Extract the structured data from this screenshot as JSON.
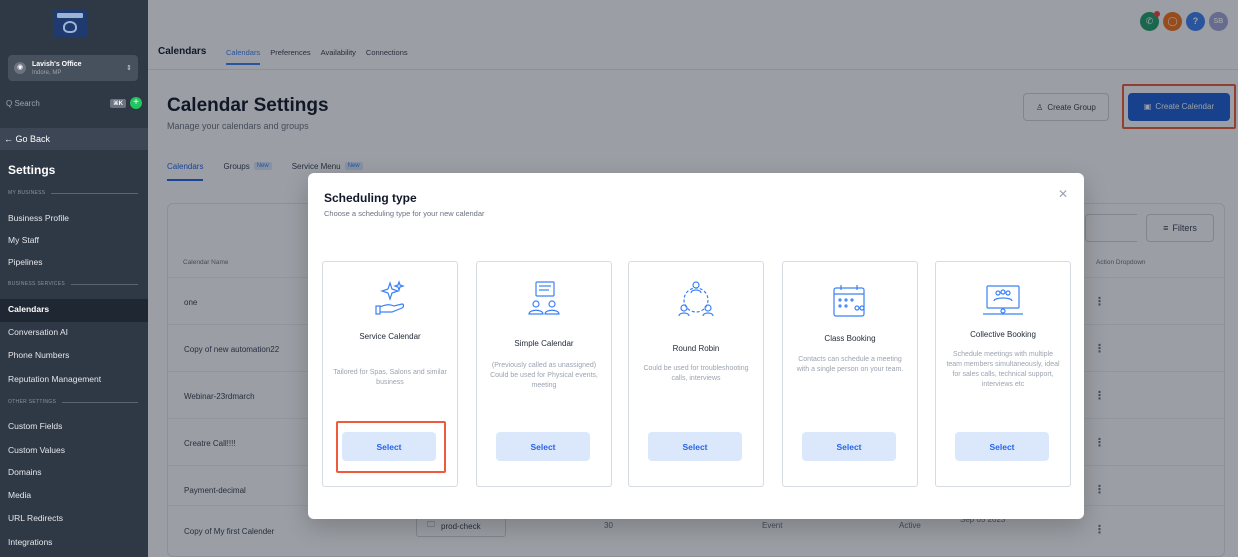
{
  "colors": {
    "accent": "#2563eb",
    "highlight": "#ef5a3a",
    "sidebar": "#2f3845"
  },
  "sidebar": {
    "account_name": "Lavish's Office",
    "account_location": "Indore, MP",
    "search_placeholder": "Q Search",
    "shortcut": "⌘K",
    "go_back": "← Go Back",
    "title": "Settings",
    "section_my_business": "MY BUSINESS",
    "section_business_services": "BUSINESS SERVICES",
    "section_other_settings": "OTHER SETTINGS",
    "items": [
      "Business Profile",
      "My Staff",
      "Pipelines",
      "Calendars",
      "Conversation AI",
      "Phone Numbers",
      "Reputation Management",
      "Custom Fields",
      "Custom Values",
      "Domains",
      "Media",
      "URL Redirects",
      "Integrations"
    ]
  },
  "topbar": {
    "title": "Calendars",
    "tabs": [
      "Calendars",
      "Preferences",
      "Availability",
      "Connections"
    ],
    "avatar_initials": "SB"
  },
  "page": {
    "title": "Calendar Settings",
    "subtitle": "Manage your calendars and groups",
    "create_group": "Create Group",
    "create_calendar": "Create Calendar",
    "subtabs": [
      "Calendars",
      "Groups",
      "Service Menu"
    ],
    "new_badge": "New",
    "filters": "Filters",
    "columns": {
      "name": "Calendar Name",
      "action": "Action Dropdown"
    },
    "rows": [
      "one",
      "Copy of new automation22",
      "Webinar-23rdmarch",
      "Creatre Call!!!!",
      "Payment-decimal",
      "Copy of My first Calender"
    ],
    "last_row": {
      "group": "prod-check",
      "duration": "30",
      "type": "Event",
      "status": "Active",
      "date": "Sep 05 2023"
    }
  },
  "modal": {
    "title": "Scheduling type",
    "subtitle": "Choose a scheduling type for your new calendar",
    "select_label": "Select",
    "cards": [
      {
        "title": "Service Calendar",
        "desc": "Tailored for Spas, Salons and similar business"
      },
      {
        "title": "Simple Calendar",
        "desc": "(Previously called as unassigned) Could be used for Physical events, meeting"
      },
      {
        "title": "Round Robin",
        "desc": "Could be used for troubleshooting calls, interviews"
      },
      {
        "title": "Class Booking",
        "desc": "Contacts can schedule a meeting with a single person on your team."
      },
      {
        "title": "Collective Booking",
        "desc": "Schedule meetings with multiple team members simultaneously, ideal for sales calls, technical support, interviews etc"
      }
    ]
  }
}
